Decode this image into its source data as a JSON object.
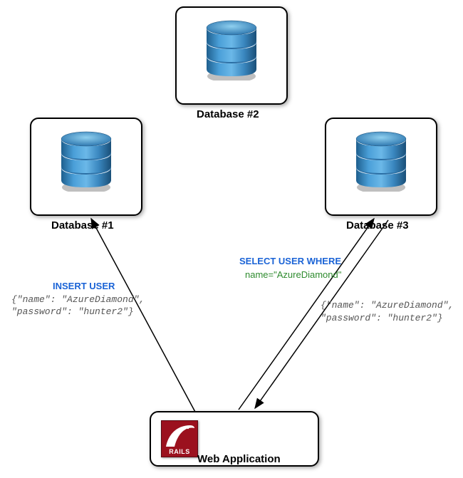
{
  "nodes": {
    "db1": {
      "label": "Database #1"
    },
    "db2": {
      "label": "Database #2"
    },
    "db3": {
      "label": "Database #3"
    },
    "webapp": {
      "label": "Web Application",
      "logo_text": "RAILS"
    }
  },
  "annotations": {
    "insert": {
      "keyword": "INSERT USER",
      "line1": "{\"name\": \"AzureDiamond\",",
      "line2": "\"password\": \"hunter2\"}"
    },
    "select": {
      "keyword": "SELECT USER WHERE",
      "value_prefix": "name=",
      "value": "\"AzureDiamond\""
    },
    "result": {
      "line1": "{\"name\": \"AzureDiamond\",",
      "line2": "\"password\": \"hunter2\"}"
    }
  }
}
